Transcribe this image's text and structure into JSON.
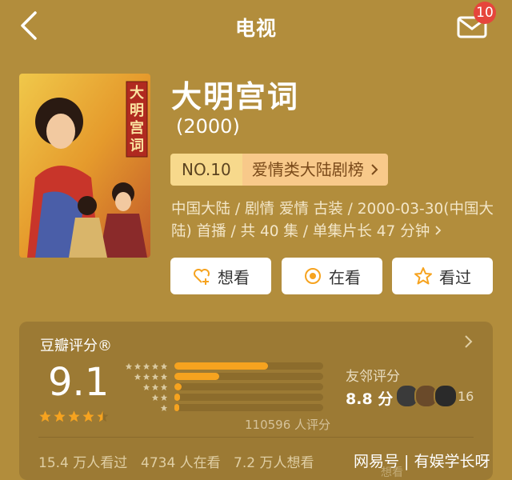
{
  "header": {
    "title": "电视",
    "mail_badge": "10"
  },
  "show": {
    "title": "大明宫词",
    "year": "(2000)",
    "poster_title": "大明宫词",
    "rank_no": "NO.10",
    "rank_name": "爱情类大陆剧榜",
    "meta_line1": "中国大陆 / 剧情 爱情 古装 / 2000-03-30(中国大",
    "meta_line2": "陆) 首播 / 共 40 集 / 单集片长 47 分钟"
  },
  "actions": {
    "want": "想看",
    "watching": "在看",
    "watched": "看过"
  },
  "rating": {
    "title": "豆瓣评分®",
    "score": "9.1",
    "stars_value": 4.5,
    "distribution": [
      0.63,
      0.3,
      0.05,
      0.04,
      0.03
    ],
    "count_text": "110596 人评分",
    "friend_label": "友邻评分",
    "friend_score": "8.8 分",
    "friend_count": "16",
    "watched_text": "15.4 万人看过",
    "watching_text": "4734 人在看",
    "want_text": "7.2 万人想看",
    "watermark": "网易号 | 有娱学长呀",
    "faded_want": "想看"
  },
  "colors": {
    "accent": "#f6a31f",
    "badge": "#e6453c",
    "background": "#b28d3c"
  }
}
